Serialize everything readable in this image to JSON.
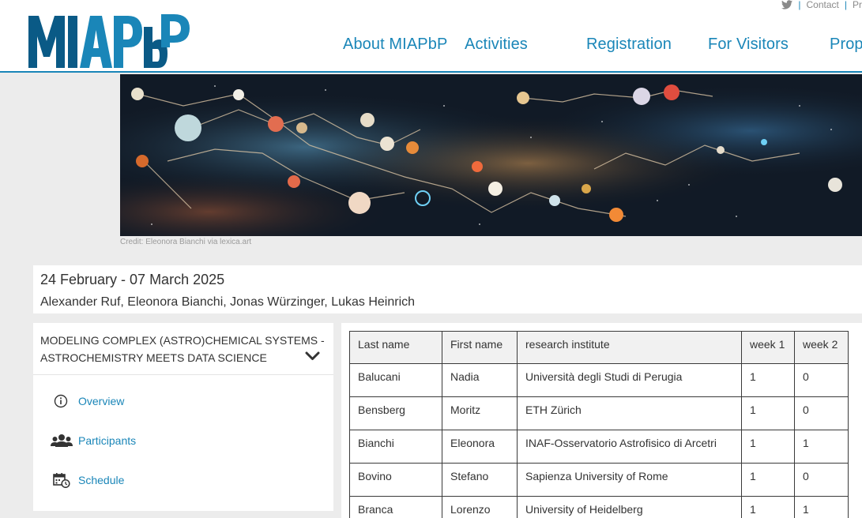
{
  "header": {
    "logo_text": "MIAPbP",
    "util": {
      "twitter_icon": "twitter-icon",
      "sep": "|",
      "contact": "Contact",
      "cut_link": "Pr"
    },
    "nav": [
      "About MIAPbP",
      "Activities",
      "Registration",
      "For Visitors",
      "Prop"
    ]
  },
  "banner": {
    "credit": "Credit: Eleonora Bianchi via lexica.art"
  },
  "program": {
    "dates": "24 February - 07 March 2025",
    "organizers": "Alexander Ruf, Eleonora Bianchi, Jonas Würzinger, Lukas Heinrich"
  },
  "sidebar": {
    "title": "MODELING COMPLEX (ASTRO)CHEMICAL SYSTEMS - ASTROCHEMISTRY MEETS DATA SCIENCE",
    "toggle_icon": "chevron-down-icon",
    "items": [
      {
        "label": "Overview",
        "icon": "info-icon"
      },
      {
        "label": "Participants",
        "icon": "people-icon"
      },
      {
        "label": "Schedule",
        "icon": "calendar-clock-icon"
      }
    ]
  },
  "participants": {
    "columns": [
      "Last name",
      "First name",
      "research institute",
      "week 1",
      "week 2"
    ],
    "rows": [
      [
        "Balucani",
        "Nadia",
        "Università degli Studi di Perugia",
        "1",
        "0"
      ],
      [
        "Bensberg",
        "Moritz",
        "ETH Zürich",
        "1",
        "0"
      ],
      [
        "Bianchi",
        "Eleonora",
        "INAF-Osservatorio Astrofisico di Arcetri",
        "1",
        "1"
      ],
      [
        "Bovino",
        "Stefano",
        "Sapienza University of Rome",
        "1",
        "0"
      ],
      [
        "Branca",
        "Lorenzo",
        "University of Heidelberg",
        "1",
        "1"
      ]
    ]
  },
  "colors": {
    "accent": "#1a86b8",
    "logo_dark": "#0a5a86",
    "logo_light": "#1a86b8",
    "background": "#ececec"
  }
}
